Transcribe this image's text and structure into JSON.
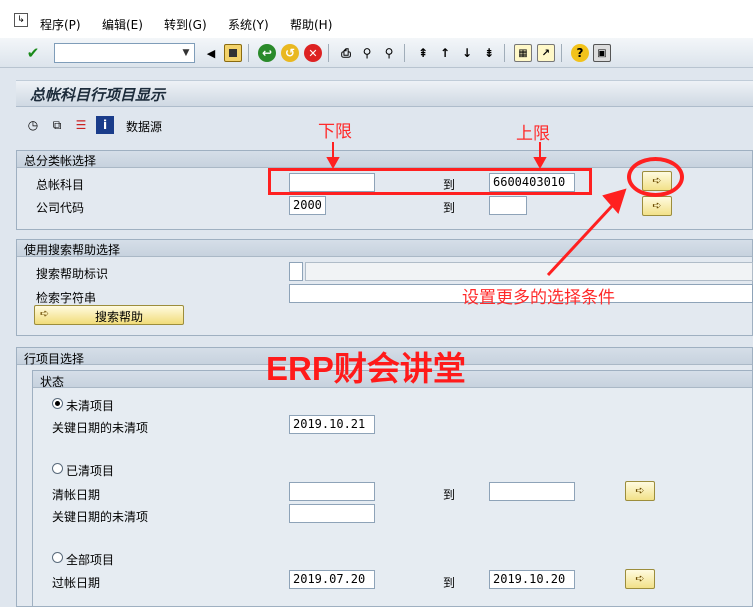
{
  "menu": {
    "items": [
      "程序(P)",
      "编辑(E)",
      "转到(G)",
      "系统(Y)",
      "帮助(H)"
    ]
  },
  "toolbar": {
    "command_field_value": ""
  },
  "page": {
    "title": "总帐科目行项目显示",
    "app_toolbar_datasource": "数据源"
  },
  "gl_selection": {
    "heading": "总分类帐选择",
    "account_label": "总帐科目",
    "account_from": "",
    "account_to": "6600403010",
    "company_label": "公司代码",
    "company_from": "2000",
    "company_to": "",
    "to_label": "到"
  },
  "search_help": {
    "heading": "使用搜索帮助选择",
    "id_label": "搜索帮助标识",
    "string_label": "检索字符串",
    "button_label": "搜索帮助"
  },
  "line_items": {
    "heading": "行项目选择",
    "status_heading": "状态",
    "open_items_label": "未清项目",
    "open_key_date_label": "关键日期的未清项",
    "open_key_date": "2019.10.21",
    "cleared_items_label": "已清项目",
    "clearing_date_label": "清帐日期",
    "clearing_from": "",
    "clearing_to": "",
    "cleared_key_date_label": "关键日期的未清项",
    "cleared_key_date": "",
    "all_items_label": "全部项目",
    "posting_date_label": "过帐日期",
    "posting_from": "2019.07.20",
    "posting_to": "2019.10.20",
    "to_label": "到",
    "selected_status": "未清项目"
  },
  "annotations": {
    "lower_limit": "下限",
    "upper_limit": "上限",
    "more_conditions": "设置更多的选择条件",
    "watermark": "ERP财会讲堂",
    "accent_color": "#ff2020"
  }
}
